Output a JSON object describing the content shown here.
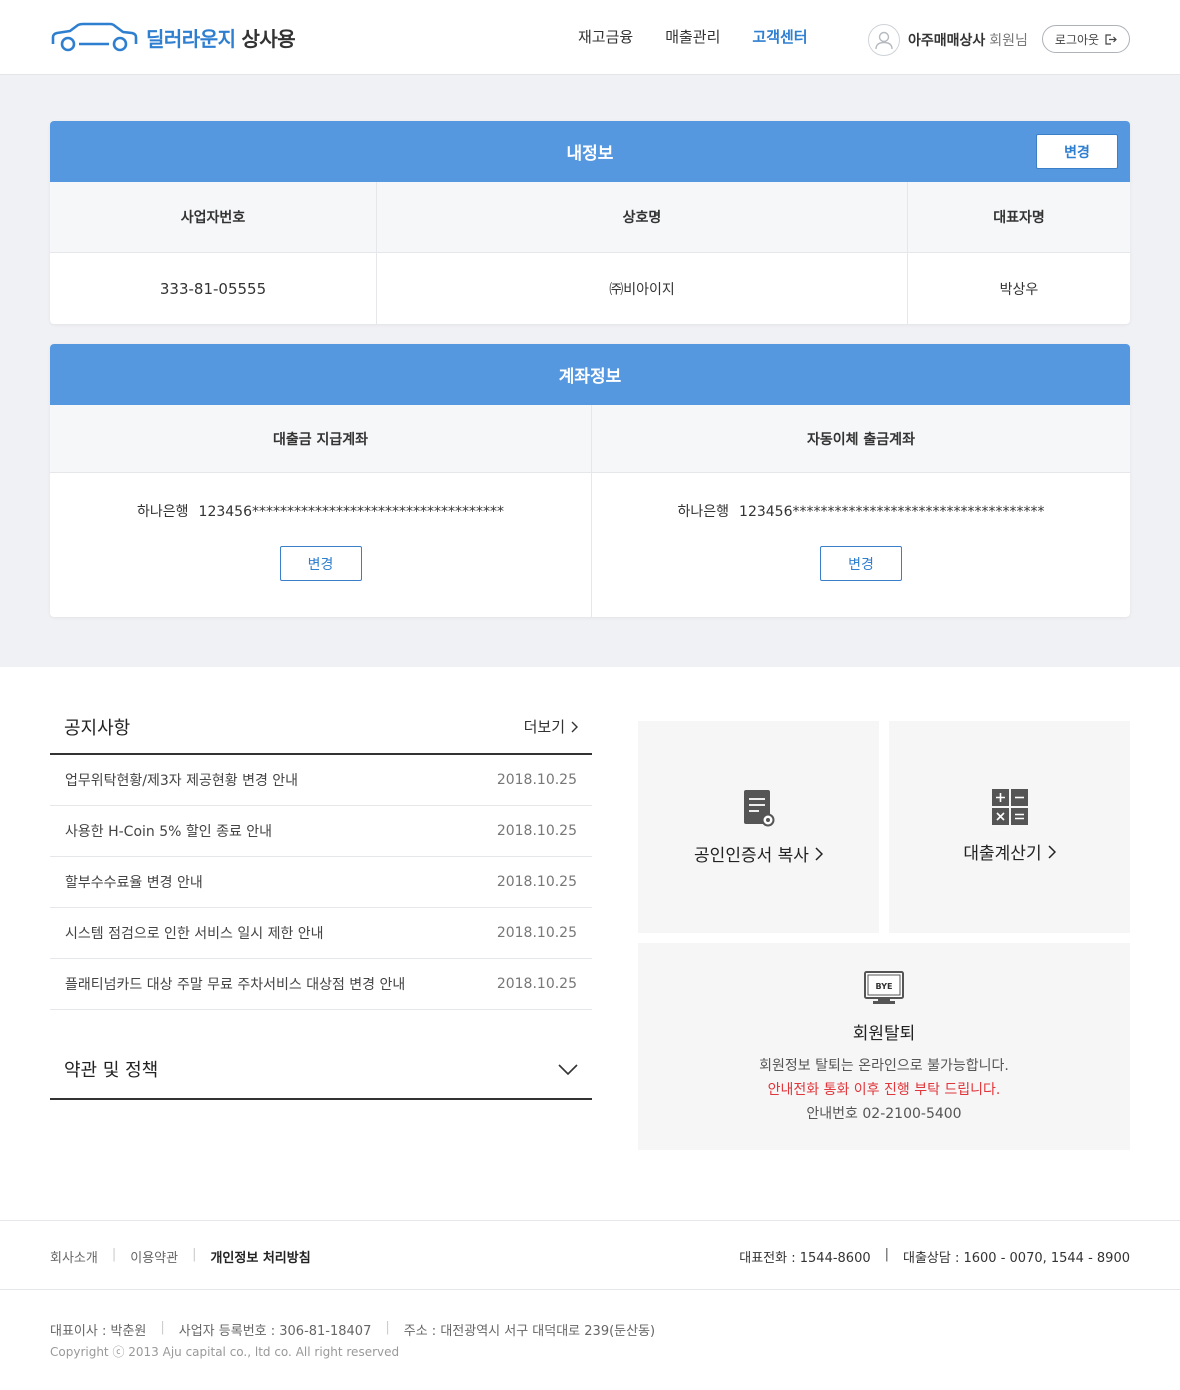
{
  "header": {
    "brand": "딜러라운지",
    "brand_sub": "상사용",
    "nav": [
      "재고금융",
      "매출관리",
      "고객센터"
    ],
    "user_name": "아주매매상사",
    "user_suffix": "회원님",
    "logout": "로그아웃"
  },
  "my_info": {
    "title": "내정보",
    "edit_label": "변경",
    "headers": [
      "사업자번호",
      "상호명",
      "대표자명"
    ],
    "values": [
      "333-81-05555",
      "㈜비아이지",
      "박상우"
    ]
  },
  "account_info": {
    "title": "계좌정보",
    "columns": [
      {
        "header": "대출금 지급계좌",
        "bank": "하나은행",
        "number": "123456************************************",
        "button": "변경"
      },
      {
        "header": "자동이체 출금계좌",
        "bank": "하나은행",
        "number": "123456************************************",
        "button": "변경"
      }
    ]
  },
  "notice": {
    "title": "공지사항",
    "more": "더보기",
    "items": [
      {
        "title": "업무위탁현황/제3자 제공현황 변경 안내",
        "date": "2018.10.25"
      },
      {
        "title": "사용한 H-Coin 5% 할인 종료 안내",
        "date": "2018.10.25"
      },
      {
        "title": "할부수수료율 변경 안내",
        "date": "2018.10.25"
      },
      {
        "title": "시스템 점검으로 인한 서비스 일시 제한 안내",
        "date": "2018.10.25"
      },
      {
        "title": "플래티넘카드 대상 주말 무료 주차서비스 대상점 변경 안내",
        "date": "2018.10.25"
      }
    ]
  },
  "terms": {
    "title": "약관 및 정책"
  },
  "tiles": {
    "cert": "공인인증서 복사",
    "calc": "대출계산기",
    "withdraw": {
      "icon_text": "BYE",
      "title": "회원탈퇴",
      "desc": "회원정보 탈퇴는 온라인으로 불가능합니다.",
      "warn": "안내전화 통화 이후 진행 부탁 드립니다.",
      "phone_label": "안내번호",
      "phone": "02-2100-5400"
    }
  },
  "footer": {
    "links": [
      "회사소개",
      "이용약관",
      "개인정보 처리방침"
    ],
    "main_phone": "대표전화 : 1544-8600",
    "loan_phone": "대출상담 : 1600 - 0070, 1544 - 8900",
    "ceo": "대표이사 : 박춘원",
    "biz_no": "사업자 등록번호 : 306-81-18407",
    "address": "주소 : 대전광역시 서구 대덕대로 239(둔산동)",
    "copyright": "Copyright ⓒ 2013 Aju capital co., ltd co. All right reserved"
  },
  "colors": {
    "primary": "#5598e0",
    "accent": "#2f7fd0",
    "warn": "#e0353a"
  }
}
